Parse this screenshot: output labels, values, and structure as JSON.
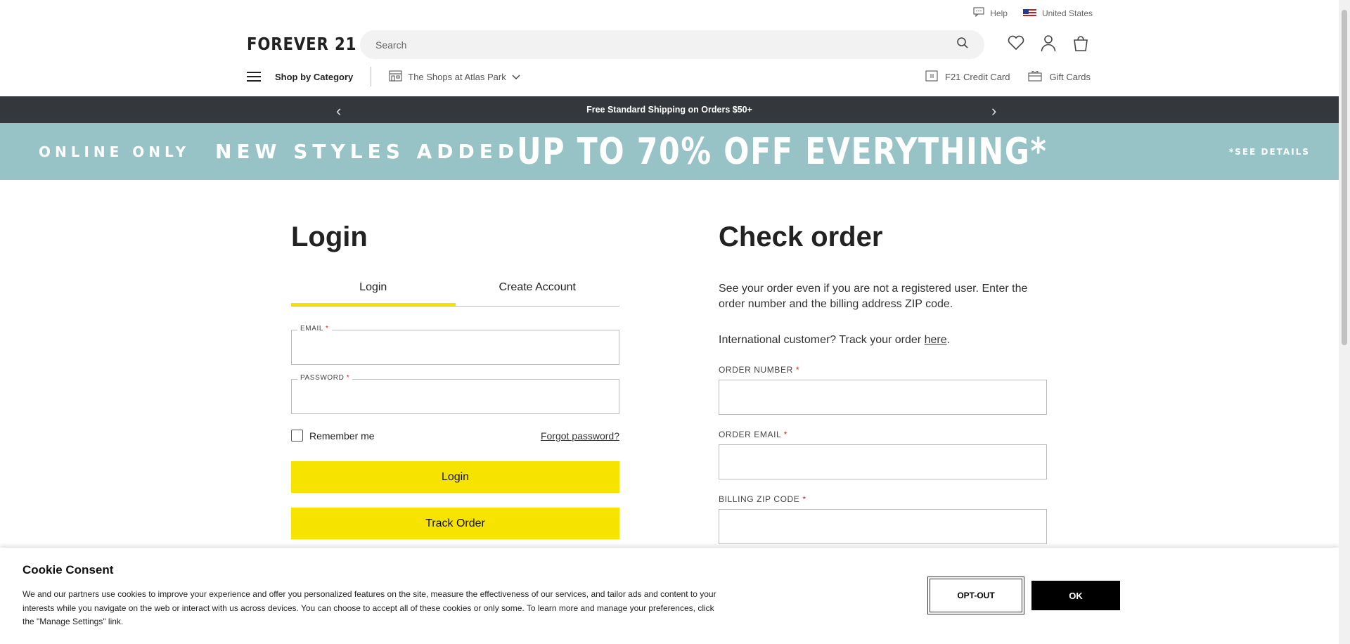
{
  "topbar": {
    "help": "Help",
    "region": "United States"
  },
  "header": {
    "logo": "FOREVER 21",
    "search_placeholder": "Search"
  },
  "nav": {
    "shop_by_category": "Shop by Category",
    "store": "The Shops at Atlas Park",
    "credit_card": "F21 Credit Card",
    "gift_cards": "Gift Cards"
  },
  "promo": {
    "text": "Free Standard Shipping on Orders $50+"
  },
  "banner": {
    "online_only": "ONLINE ONLY",
    "new_styles": "NEW STYLES ADDED!",
    "headline": "UP TO 70% OFF EVERYTHING*",
    "see_details": "*SEE DETAILS"
  },
  "login": {
    "title": "Login",
    "tabs": [
      "Login",
      "Create Account"
    ],
    "email_label": "EMAIL",
    "password_label": "PASSWORD",
    "required_mark": "*",
    "remember_me": "Remember me",
    "forgot_password": "Forgot password?",
    "login_button": "Login",
    "track_order_button": "Track Order"
  },
  "check_order": {
    "title": "Check order",
    "description": "See your order even if you are not a registered user. Enter the order number and the billing address ZIP code.",
    "intl_text": "International customer? Track your order ",
    "intl_link": "here",
    "intl_end": ".",
    "order_number_label": "ORDER NUMBER",
    "order_email_label": "ORDER EMAIL",
    "billing_zip_label": "BILLING ZIP CODE",
    "required_mark": "*"
  },
  "cookie": {
    "title": "Cookie Consent",
    "text": "We and our partners use cookies to improve your experience and offer you personalized features on the site, measure the effectiveness of our services, and tailor ads and content to your interests while you navigate on the web or interact with us across devices. You can choose to accept all of these cookies or only some. To learn more and manage your preferences, click the \"Manage Settings\" link.",
    "opt_out": "OPT-OUT",
    "ok": "OK"
  }
}
